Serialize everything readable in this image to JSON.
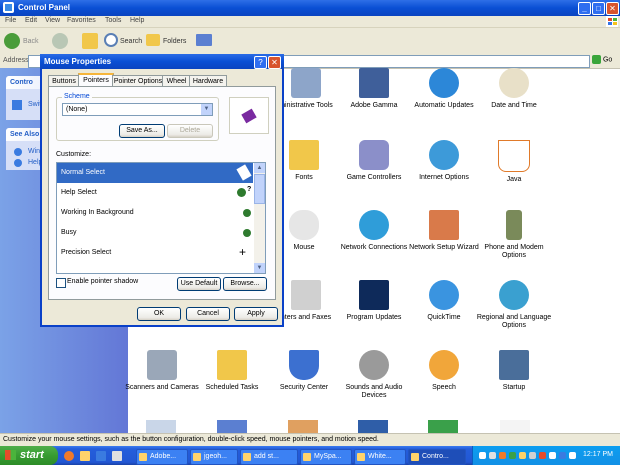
{
  "window": {
    "title": "Control Panel",
    "menu": [
      "File",
      "Edit",
      "View",
      "Favorites",
      "Tools",
      "Help"
    ],
    "toolbar": {
      "back": "Back",
      "search": "Search",
      "folders": "Folders"
    },
    "address_label": "Address",
    "go_label": "Go"
  },
  "taskpane": {
    "control_title": "Contro",
    "switch_item": "Swit",
    "see_also_title": "See Also",
    "see_also_items": [
      "Wind",
      "Help"
    ]
  },
  "items": [
    {
      "label": "ministrative Tools",
      "icon": "administrative-tools-icon"
    },
    {
      "label": "Adobe Gamma",
      "icon": "adobe-gamma-icon"
    },
    {
      "label": "Automatic Updates",
      "icon": "automatic-updates-icon"
    },
    {
      "label": "Date and Time",
      "icon": "date-time-icon"
    },
    {
      "label": "Fonts",
      "icon": "fonts-icon"
    },
    {
      "label": "Game Controllers",
      "icon": "game-controllers-icon"
    },
    {
      "label": "Internet Options",
      "icon": "internet-options-icon"
    },
    {
      "label": "Java",
      "icon": "java-icon"
    },
    {
      "label": "Mouse",
      "icon": "mouse-icon"
    },
    {
      "label": "Network Connections",
      "icon": "network-connections-icon"
    },
    {
      "label": "Network Setup Wizard",
      "icon": "network-setup-wizard-icon"
    },
    {
      "label": "Phone and Modem Options",
      "icon": "phone-modem-icon"
    },
    {
      "label": "nters and Faxes",
      "icon": "printers-faxes-icon"
    },
    {
      "label": "Program Updates",
      "icon": "program-updates-icon"
    },
    {
      "label": "QuickTime",
      "icon": "quicktime-icon"
    },
    {
      "label": "Regional and Language Options",
      "icon": "regional-language-icon"
    },
    {
      "label": "Scanners and Cameras",
      "icon": "scanners-cameras-icon"
    },
    {
      "label": "Scheduled Tasks",
      "icon": "scheduled-tasks-icon"
    },
    {
      "label": "Security Center",
      "icon": "security-center-icon"
    },
    {
      "label": "Sounds and Audio Devices",
      "icon": "sounds-audio-icon"
    },
    {
      "label": "Speech",
      "icon": "speech-icon"
    },
    {
      "label": "Startup",
      "icon": "startup-icon"
    }
  ],
  "statusbar": "Customize your mouse settings, such as the button configuration, double-click speed, mouse pointers, and motion speed.",
  "dialog": {
    "title": "Mouse Properties",
    "tabs": [
      "Buttons",
      "Pointers",
      "Pointer Options",
      "Wheel",
      "Hardware"
    ],
    "selected_tab": "Pointers",
    "scheme_label": "Scheme",
    "scheme_value": "(None)",
    "save_as": "Save As...",
    "delete": "Delete",
    "customize_label": "Customize:",
    "pointers": [
      "Normal Select",
      "Help Select",
      "Working In Background",
      "Busy",
      "Precision Select"
    ],
    "shadow_label": "Enable pointer shadow",
    "use_default": "Use Default",
    "browse": "Browse...",
    "ok": "OK",
    "cancel": "Cancel",
    "apply": "Apply",
    "help_glyph": "?",
    "close_glyph": "✕"
  },
  "taskbar": {
    "start": "start",
    "tasks": [
      "Adobe...",
      "jgeoh...",
      "add st...",
      "MySpa...",
      "White...",
      "Contro..."
    ],
    "clock": "12:17 PM"
  }
}
